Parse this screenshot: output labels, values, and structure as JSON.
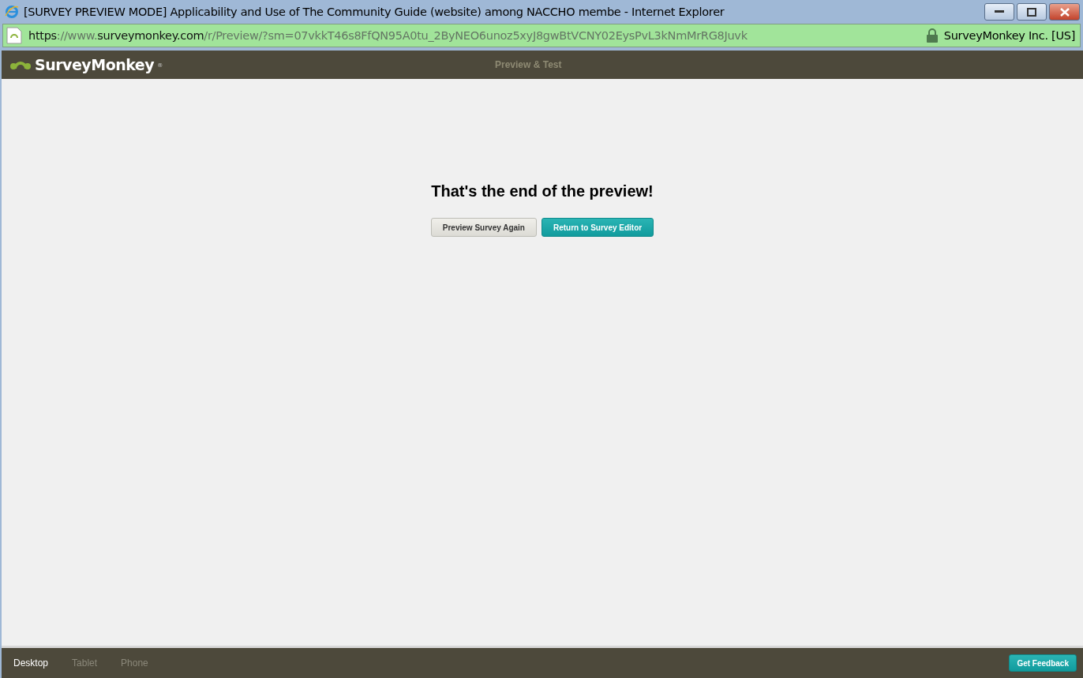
{
  "window": {
    "title": "[SURVEY PREVIEW MODE] Applicability and Use of The Community Guide (website) among NACCHO membe - Internet Explorer"
  },
  "address_bar": {
    "url_parts": [
      {
        "text": "https",
        "strong": true
      },
      {
        "text": "://www.",
        "strong": false
      },
      {
        "text": "surveymonkey.com",
        "strong": true
      },
      {
        "text": "/r/Preview/?sm=07vkkT46s8FfQN95A0tu_2ByNEO6unoz5xyJ8gwBtVCNY02EysPvL3kNmMrRG8Juvk",
        "strong": false
      }
    ],
    "certificate": "SurveyMonkey Inc. [US]"
  },
  "header": {
    "logo": "SurveyMonkey",
    "logo_mark": "®",
    "title": "Preview & Test"
  },
  "main": {
    "heading": "That's the end of the preview!",
    "buttons": [
      {
        "label": "Preview Survey Again",
        "kind": "secondary"
      },
      {
        "label": "Return to Survey Editor",
        "kind": "primary"
      }
    ]
  },
  "footer": {
    "devices": [
      {
        "label": "Desktop",
        "selected": true
      },
      {
        "label": "Tablet",
        "selected": false
      },
      {
        "label": "Phone",
        "selected": false
      }
    ],
    "feedback_button": "Get Feedback"
  }
}
